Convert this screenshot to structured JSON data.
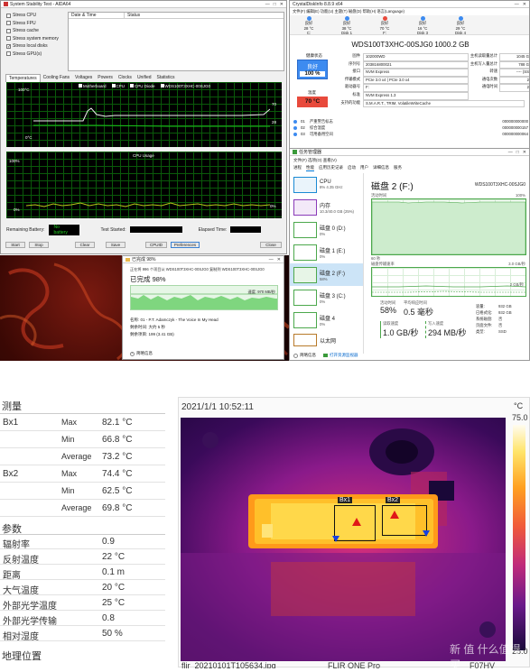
{
  "aida": {
    "title": "System Stability Test - AIDA64",
    "stress_items": [
      {
        "label": "Stress CPU",
        "checked": false
      },
      {
        "label": "Stress FPU",
        "checked": false
      },
      {
        "label": "Stress cache",
        "checked": false
      },
      {
        "label": "Stress system memory",
        "checked": false
      },
      {
        "label": "Stress local disks",
        "checked": true
      },
      {
        "label": "Stress GPU(s)",
        "checked": false
      }
    ],
    "col_date": "Date & Time",
    "col_status": "Status",
    "tabs": [
      "Temperatures",
      "Cooling Fans",
      "Voltages",
      "Powers",
      "Clocks",
      "Unified",
      "Statistics"
    ],
    "legend": [
      "Motherboard",
      "CPU",
      "CPU Diode",
      "WDS100T3XHC-00SJG0"
    ],
    "temp_top": "100°C",
    "temp_bottom": "0°C",
    "temp_right_a": "70",
    "temp_right_b": "28",
    "cpu_title": "CPU Usage",
    "cpu_top": "100%",
    "cpu_bottom": "0%",
    "cpu_right": "0%",
    "battery_label": "Remaining Battery:",
    "battery_value": "No battery",
    "started_label": "Test Started:",
    "elapsed_label": "Elapsed Time:",
    "buttons": [
      "Start",
      "Stop",
      "Clear",
      "Save",
      "CPUID",
      "Preferences",
      "Close"
    ]
  },
  "crystal": {
    "title": "CrystalDiskInfo 8.8.9 x64",
    "menu": "文件(F) 编辑(E) 功能(U) 主题(T) 磁盘(D) 帮助(H) 语言(Language)",
    "temps": [
      {
        "status": "良好",
        "temp": "28 °C",
        "name": "C:"
      },
      {
        "status": "良好",
        "temp": "38 °C",
        "name": "Disk 1"
      },
      {
        "status": "良好",
        "temp": "70 °C",
        "name": "F:"
      },
      {
        "status": "良好",
        "temp": "16 °C",
        "name": "Disk 3"
      },
      {
        "status": "良好",
        "temp": "29 °C",
        "name": "Disk 4"
      }
    ],
    "drive_title": "WDS100T3XHC-00SJG0 1000.2 GB",
    "health_label": "健康状态",
    "health_status": "良好",
    "health_pct": "100 %",
    "temp_label": "温度",
    "temp_value": "70 °C",
    "info_left": [
      {
        "k": "固件",
        "v": "102000WD"
      },
      {
        "k": "序列号",
        "v": "203816800021"
      },
      {
        "k": "接口",
        "v": "NVM Express"
      },
      {
        "k": "传输模式",
        "v": "PCIe 3.0 x4 | PCIe 3.0 x4"
      },
      {
        "k": "驱动器号",
        "v": "F:"
      },
      {
        "k": "标准",
        "v": "NVM Express 1.3"
      },
      {
        "k": "支持的功能",
        "v": "S.M.A.R.T., TRIM, VolatileWriteCache"
      }
    ],
    "info_right": [
      {
        "k": "主机读取量总计",
        "v": "1045 G"
      },
      {
        "k": "主机写入量总计",
        "v": "788 G"
      },
      {
        "k": "转速",
        "v": "---- (SS"
      },
      {
        "k": "通电次数",
        "v": "2"
      },
      {
        "k": "通电时间",
        "v": "2"
      }
    ],
    "smart_rows": [
      {
        "id": "01",
        "name": "严重警告标志",
        "raw": "000000000000"
      },
      {
        "id": "02",
        "name": "综合温度",
        "raw": "000000000157"
      },
      {
        "id": "03",
        "name": "可用备用空间",
        "raw": "000000000064"
      }
    ]
  },
  "taskmgr": {
    "title": "任务管理器",
    "menu": "文件(F) 选项(O) 查看(V)",
    "tabs": [
      "进程",
      "性能",
      "应用历史记录",
      "启动",
      "用户",
      "详细信息",
      "服务"
    ],
    "items": [
      {
        "name": "CPU",
        "sub": "8% 4.35 GHz"
      },
      {
        "name": "内存",
        "sub": "10.3/40.0 GB (25%)"
      },
      {
        "name": "磁盘 0 (D:)",
        "sub": "0%"
      },
      {
        "name": "磁盘 1 (E:)",
        "sub": "0%"
      },
      {
        "name": "磁盘 2 (F:)",
        "sub": "58%"
      },
      {
        "name": "磁盘 3 (C:)",
        "sub": "0%"
      },
      {
        "name": "磁盘 4",
        "sub": "0%"
      },
      {
        "name": "以太网",
        "sub": ""
      }
    ],
    "disk_title": "磁盘 2 (F:)",
    "disk_model": "WDS100T3XHC-00SJG0",
    "active_label": "活动时间",
    "graph_top": "100%",
    "graph_span": "60 秒",
    "xfer_label": "磁盘传输速率",
    "xfer_top": "3.0 GB/秒",
    "xfer_mid": "2 GB/秒",
    "stat_active_label": "活动时间",
    "stat_active": "58%",
    "stat_resp_label": "平均响应时间",
    "stat_resp": "0.5 毫秒",
    "stat_read_label": "读取速度",
    "stat_read": "1.0 GB/秒",
    "stat_write_label": "写入速度",
    "stat_write": "294 MB/秒",
    "cap_rows": [
      {
        "k": "容量:",
        "v": "932 GB"
      },
      {
        "k": "已格式化:",
        "v": "932 GB"
      },
      {
        "k": "系统磁盘:",
        "v": "否"
      },
      {
        "k": "页面文件:",
        "v": "否"
      },
      {
        "k": "类型:",
        "v": "SSD"
      }
    ],
    "less_detail": "简略信息",
    "open_monitor": "打开资源监视器"
  },
  "copy": {
    "title": "已完成 98%",
    "line": "正在将 996 个项目从 WDS100T3XHC-00SJG0 复制到 WDS100T3XHC-00SJG0",
    "progress_label": "已完成 98%",
    "progress": 0.98,
    "speed": "速度: 970 MB/秒",
    "name": "名称: 01 - P.T. Adamczyk - The Voice In My Head",
    "time_left": "剩余时间: 大约 5 秒",
    "items_left": "剩余项目: 199 (3.41 GB)",
    "less_info": "简略信息"
  },
  "measure": {
    "section_measure": "测量",
    "rows": [
      {
        "a": "Bx1",
        "b": "Max",
        "c": "82.1 °C"
      },
      {
        "a": "",
        "b": "Min",
        "c": "66.8 °C"
      },
      {
        "a": "",
        "b": "Average",
        "c": "73.2 °C"
      },
      {
        "a": "Bx2",
        "b": "Max",
        "c": "74.4 °C"
      },
      {
        "a": "",
        "b": "Min",
        "c": "62.5 °C"
      },
      {
        "a": "",
        "b": "Average",
        "c": "69.8 °C"
      }
    ],
    "section_params": "参数",
    "params": [
      {
        "k": "辐射率",
        "v": "0.9"
      },
      {
        "k": "反射温度",
        "v": "22 °C"
      },
      {
        "k": "距离",
        "v": "0.1 m"
      },
      {
        "k": "大气温度",
        "v": "20 °C"
      },
      {
        "k": "外部光学温度",
        "v": "25 °C"
      },
      {
        "k": "外部光学传输",
        "v": "0.8"
      },
      {
        "k": "相对湿度",
        "v": "50 %"
      }
    ],
    "section_geo": "地理位置"
  },
  "thermal": {
    "timestamp": "2021/1/1 10:52:11",
    "box1": "Bx1",
    "box2": "Bx2",
    "scale_unit": "°C",
    "scale_max": "75.0",
    "scale_min": "25.0",
    "filename": "flir_20210101T105634.jpg",
    "camera": "FLIR ONE Pro",
    "right_text": "F07HV",
    "watermark": "新 值 什么值得买"
  },
  "colors": {
    "win_accent": "#0078d7",
    "good_blue": "#3d8bf0",
    "hot_red": "#e84a3c",
    "graph_green": "#19b419"
  }
}
